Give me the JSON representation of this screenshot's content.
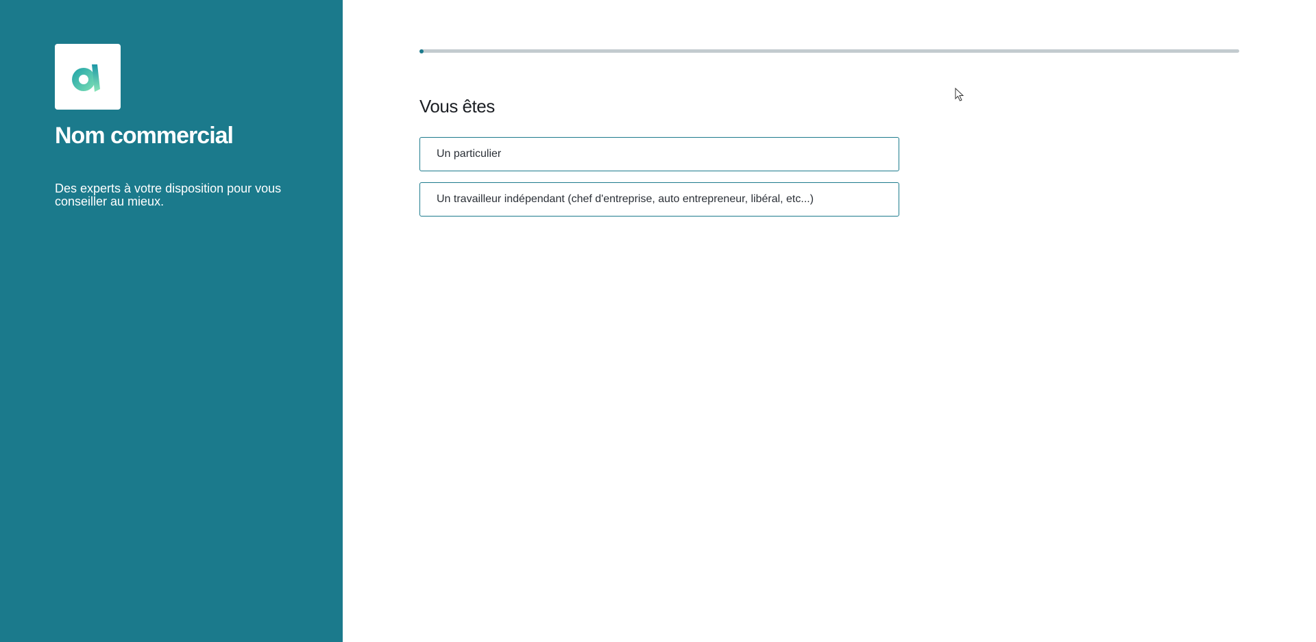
{
  "sidebar": {
    "logo_icon": "brand-a-logo-icon",
    "brand_name": "Nom commercial",
    "tagline": "Des experts à votre disposition pour vous conseiller au mieux."
  },
  "main": {
    "progress_percent": 0.5,
    "question": "Vous êtes",
    "options": [
      {
        "label": "Un particulier"
      },
      {
        "label": "Un travailleur indépendant (chef d'entreprise, auto entrepreneur, libéral, etc...)"
      }
    ]
  },
  "colors": {
    "sidebar_bg": "#1b7a8c",
    "accent": "#1b7a8c",
    "progress_track": "#c3cbcf",
    "text_dark": "#1c1f24"
  }
}
